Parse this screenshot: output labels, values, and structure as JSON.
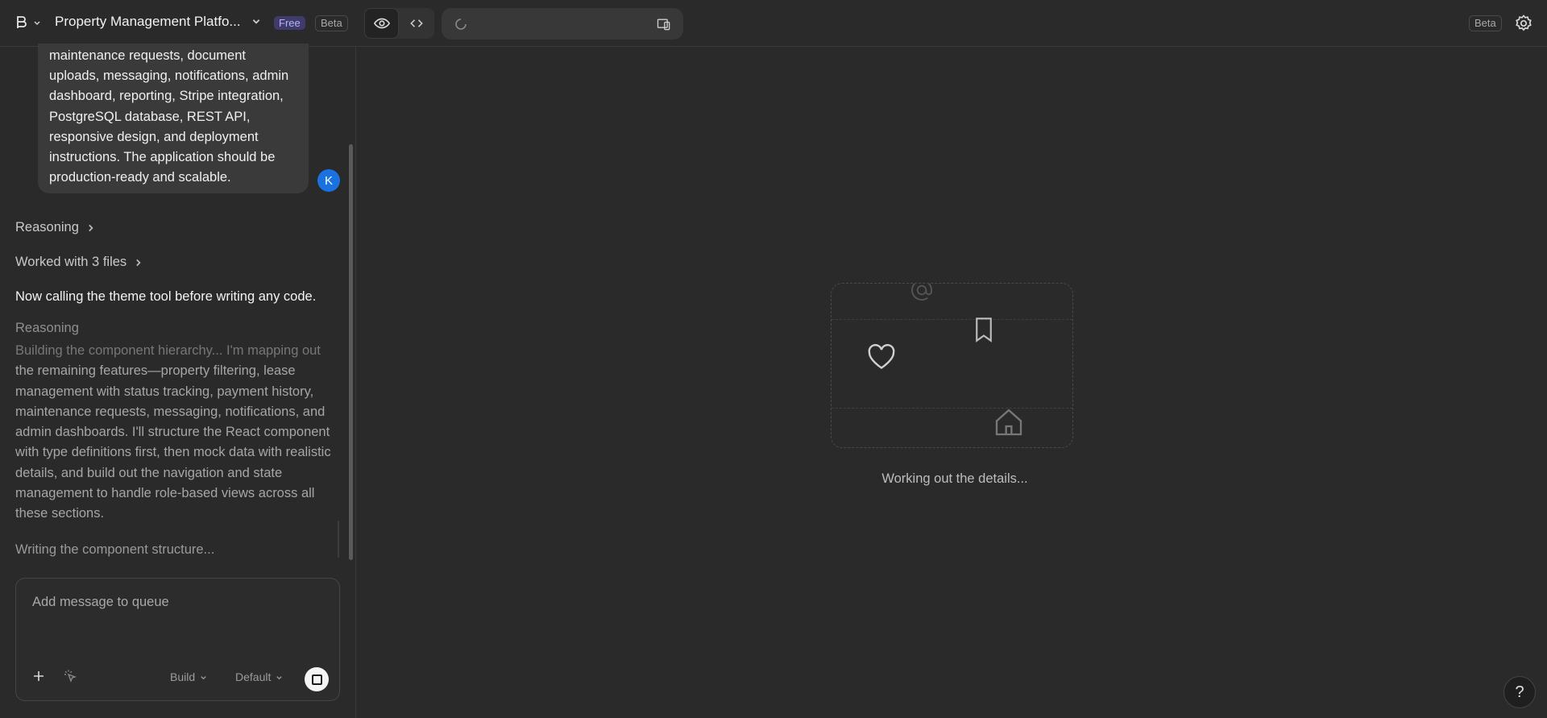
{
  "header": {
    "project_title": "Property Management Platfo...",
    "plan_badge": "Free",
    "beta_badge": "Beta",
    "right_beta_badge": "Beta"
  },
  "chat": {
    "user_message": "maintenance requests, document uploads, messaging, notifications, admin dashboard, reporting, Stripe integration, PostgreSQL database, REST API, responsive design, and deployment instructions. The application should be production-ready and scalable.",
    "user_avatar_initial": "K",
    "reasoning_label": "Reasoning",
    "worked_files_label": "Worked with 3 files",
    "status_message": "Now calling the theme tool before writing any code.",
    "reasoning_live_label": "Reasoning",
    "reasoning_fade_text": "Building the component hierarchy... I'm mapping out",
    "reasoning_text": "the remaining features—property filtering, lease management with status tracking, payment history, maintenance requests, messaging, notifications, and admin dashboards. I'll structure the React component with type definitions first, then mock data with realistic details, and build out the navigation and state management to handle role-based views across all these sections.",
    "writing_status": "Writing the component structure..."
  },
  "composer": {
    "placeholder": "Add message to queue",
    "mode_label": "Build",
    "model_label": "Default"
  },
  "preview": {
    "loading_text": "Working out the details..."
  },
  "help": {
    "label": "?"
  },
  "icons": {
    "logo": "logo-icon",
    "settings": "gear-icon",
    "preview": "eye-icon",
    "code": "code-icon",
    "spinner": "spinner-icon",
    "devices": "devices-icon",
    "add": "plus-icon",
    "enhance": "magic-cursor-icon",
    "stop": "stop-icon"
  }
}
